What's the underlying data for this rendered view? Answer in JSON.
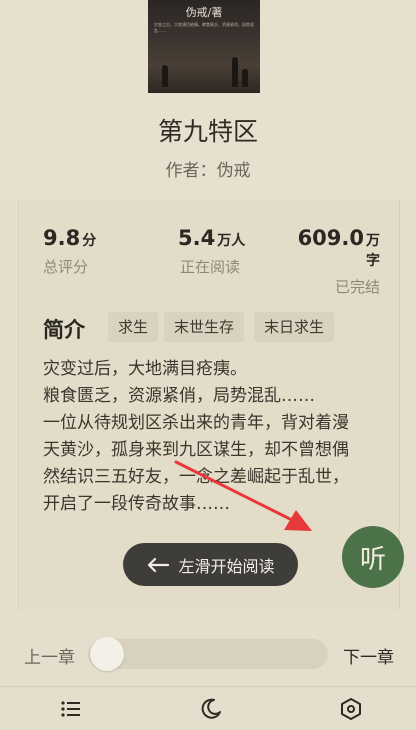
{
  "book": {
    "cover_author": "伪戒/著",
    "cover_blurb": "灾变之后，大地满目疮痍。粮食匮乏，资源紧俏，局势混乱……",
    "title": "第九特区",
    "author_line": "作者：伪戒"
  },
  "stats": [
    {
      "value": "9.8",
      "unit": "分",
      "label": "总评分"
    },
    {
      "value": "5.4",
      "unit": "万人",
      "label": "正在阅读"
    },
    {
      "value": "609.0",
      "unit": "万字",
      "label": "已完结"
    }
  ],
  "intro": {
    "heading": "简介",
    "tags": [
      "求生",
      "末世生存",
      "末日求生"
    ],
    "lines": [
      "灾变过后，大地满目疮痍。",
      "粮食匮乏，资源紧俏，局势混乱……",
      "一位从待规划区杀出来的青年，背对着漫",
      "天黄沙，孤身来到九区谋生，却不曾想偶",
      "然结识三五好友，一念之差崛起于乱世，",
      "开启了一段传奇故事……"
    ]
  },
  "actions": {
    "start_reading": "左滑开始阅读",
    "listen": "听"
  },
  "chapter_nav": {
    "prev": "上一章",
    "next": "下一章",
    "progress": 0
  },
  "bottom_bar": {
    "icons": [
      "list-icon",
      "moon-icon",
      "settings-icon"
    ]
  },
  "colors": {
    "background": "#e4dfcd",
    "listen_button": "#4b7248",
    "start_button": "#3e3d39",
    "annotation_arrow": "#e8393a"
  }
}
